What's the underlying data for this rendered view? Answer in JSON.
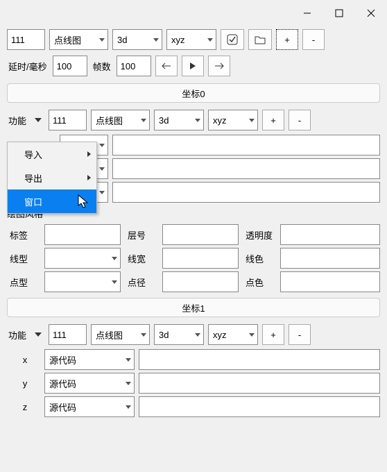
{
  "top": {
    "val": "111",
    "chart": "点线图",
    "dim": "3d",
    "axes": "xyz",
    "plus": "+",
    "minus": "-"
  },
  "timing": {
    "delay_label": "延时/毫秒",
    "delay": "100",
    "frames_label": "帧数",
    "frames": "100"
  },
  "coord0": {
    "header": "坐标0",
    "func_label": "功能",
    "val": "111",
    "chart": "点线图",
    "dim": "3d",
    "axes": "xyz",
    "plus": "+",
    "minus": "-"
  },
  "menu": {
    "import": "导入",
    "export": "导出",
    "window": "窗口"
  },
  "style": {
    "header": "绘图风格",
    "label": "标签",
    "layer": "层号",
    "opacity": "透明度",
    "linetype": "线型",
    "linewidth": "线宽",
    "linecolor": "线色",
    "pointtype": "点型",
    "pointsize": "点径",
    "pointcolor": "点色"
  },
  "coord1": {
    "header": "坐标1",
    "func_label": "功能",
    "val": "111",
    "chart": "点线图",
    "dim": "3d",
    "axes": "xyz",
    "plus": "+",
    "minus": "-",
    "x": "x",
    "y": "y",
    "z": "z",
    "src": "源代码"
  }
}
